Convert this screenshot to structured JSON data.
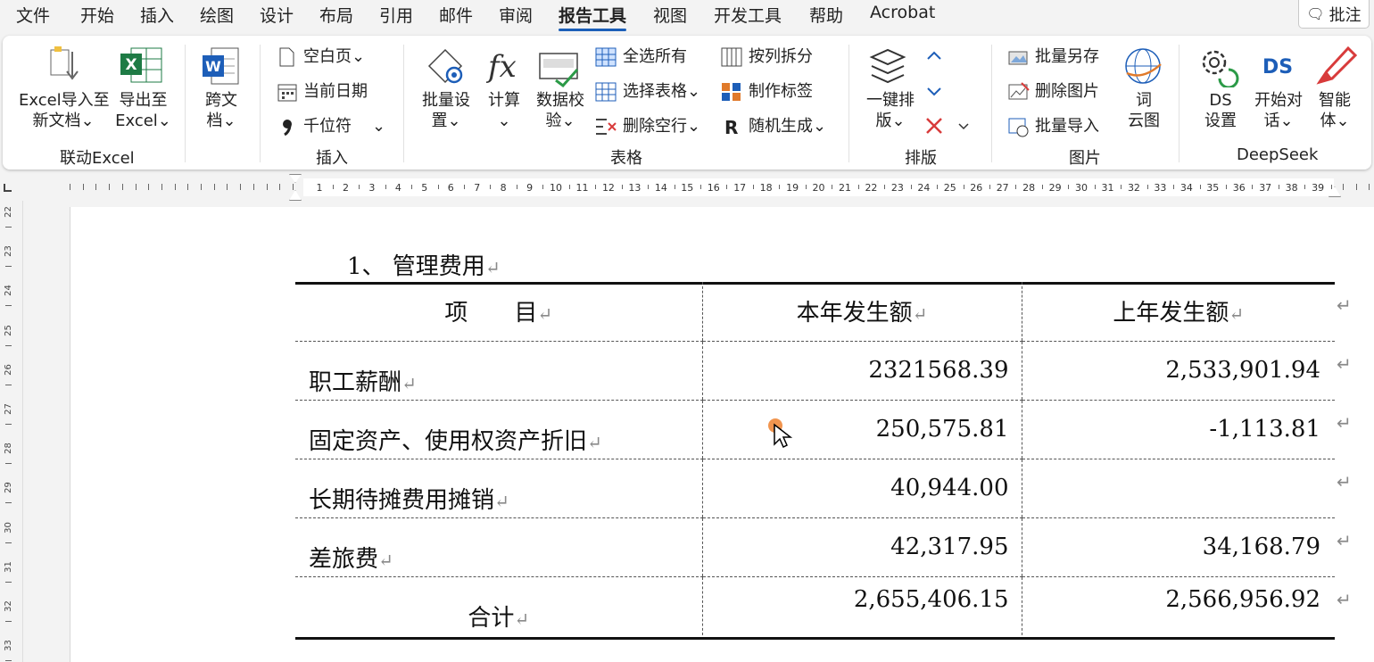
{
  "menu": {
    "tabs": [
      "文件",
      "开始",
      "插入",
      "绘图",
      "设计",
      "布局",
      "引用",
      "邮件",
      "审阅",
      "报告工具",
      "视图",
      "开发工具",
      "帮助",
      "Acrobat"
    ],
    "active_tab": "报告工具",
    "comment_label": "批注"
  },
  "ribbon": {
    "groups": {
      "excel": {
        "label": "联动Excel",
        "import_line1": "Excel导入至",
        "import_line2": "新文档⌄",
        "export_line1": "导出至",
        "export_line2": "Excel⌄"
      },
      "cross": {
        "line1": "跨文",
        "line2": "档⌄"
      },
      "insert": {
        "label": "插入",
        "blank_page": "空白页⌄",
        "current_date": "当前日期",
        "thousand_sep": "千位符",
        "more": "⌄"
      },
      "table": {
        "label": "表格",
        "batch_line1": "批量设",
        "batch_line2": "置⌄",
        "calc_line1": "计算",
        "calc_line2": "⌄",
        "verify_line1": "数据校",
        "verify_line2": "验⌄",
        "select_all": "全选所有",
        "select_table": "选择表格⌄",
        "delete_empty": "删除空行⌄",
        "split_col": "按列拆分",
        "make_label": "制作标签",
        "random_gen": "随机生成⌄"
      },
      "layout": {
        "label": "排版",
        "onekey_line1": "一键排",
        "onekey_line2": "版⌄"
      },
      "picture": {
        "label": "图片",
        "batch_save": "批量另存",
        "delete_pic": "删除图片",
        "batch_import": "批量导入",
        "wordcloud_line1": "词",
        "wordcloud_line2": "云图"
      },
      "deepseek": {
        "label": "DeepSeek",
        "ds_line1": "DS",
        "ds_line2": "设置",
        "chat_line1": "开始对",
        "chat_line2": "话⌄",
        "agent_line1": "智能",
        "agent_line2": "体⌄"
      }
    }
  },
  "ruler": {
    "h_numbers": [
      "1",
      "2",
      "3",
      "4",
      "5",
      "6",
      "7",
      "8",
      "9",
      "10",
      "11",
      "12",
      "13",
      "14",
      "15",
      "16",
      "17",
      "18",
      "19",
      "20",
      "21",
      "22",
      "23",
      "24",
      "25",
      "26",
      "27",
      "28",
      "29",
      "30",
      "31",
      "32",
      "33",
      "34",
      "35",
      "36",
      "37",
      "38",
      "39"
    ],
    "v_numbers": [
      "22",
      "23",
      "24",
      "25",
      "26",
      "27",
      "28",
      "29",
      "30",
      "31",
      "32",
      "33"
    ]
  },
  "document": {
    "heading": "1、 管理费用",
    "table": {
      "headers": [
        "项　　目",
        "本年发生额",
        "上年发生额"
      ],
      "rows": [
        {
          "item": "职工薪酬",
          "current": "2321568.39",
          "previous": "2,533,901.94"
        },
        {
          "item": "固定资产、使用权资产折旧",
          "current": "250,575.81",
          "previous": "-1,113.81"
        },
        {
          "item": "长期待摊费用摊销",
          "current": "40,944.00",
          "previous": ""
        },
        {
          "item": "差旅费",
          "current": "42,317.95",
          "previous": "34,168.79"
        }
      ],
      "total": {
        "item": "合计",
        "current": "2,655,406.15",
        "previous": "2,566,956.92"
      }
    },
    "para_mark": "↵"
  }
}
